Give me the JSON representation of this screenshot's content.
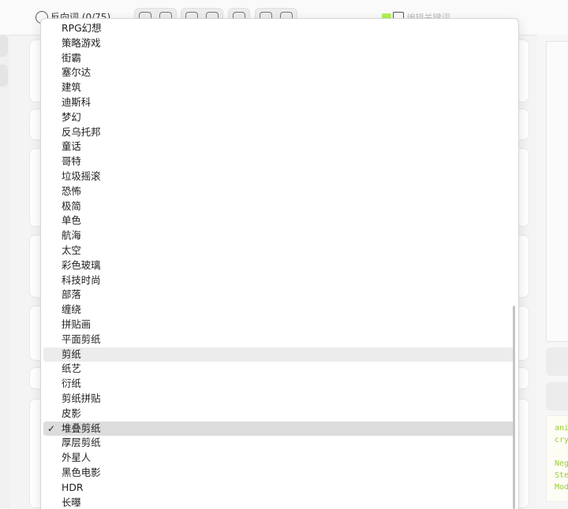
{
  "topbar": {
    "title": "反向词 (0/75)",
    "right_label": "编辑关键词"
  },
  "dropdown": {
    "options": [
      "RPG幻想",
      "策略游戏",
      "街霸",
      "塞尔达",
      "建筑",
      "迪斯科",
      "梦幻",
      "反乌托邦",
      "童话",
      "哥特",
      "垃圾摇滚",
      "恐怖",
      "极简",
      "单色",
      "航海",
      "太空",
      "彩色玻璃",
      "科技时尚",
      "部落",
      "缠绕",
      "拼贴画",
      "平面剪纸",
      "剪纸",
      "纸艺",
      "衍纸",
      "剪纸拼贴",
      "皮影",
      "堆叠剪纸",
      "厚层剪纸",
      "外星人",
      "黑色电影",
      "HDR",
      "长曝"
    ],
    "hovered_option": "剪纸",
    "selected_option": "堆叠剪纸",
    "check_glyph": "✓"
  },
  "code_snippet": {
    "lines": [
      "ani",
      "cry",
      "",
      "Neg",
      "Ste",
      "Mod"
    ]
  },
  "colors": {
    "accent_green": "#b3ef5b",
    "code_text": "#9acd32",
    "selected_bg": "#dcdcdc",
    "hover_bg": "#ececec"
  }
}
